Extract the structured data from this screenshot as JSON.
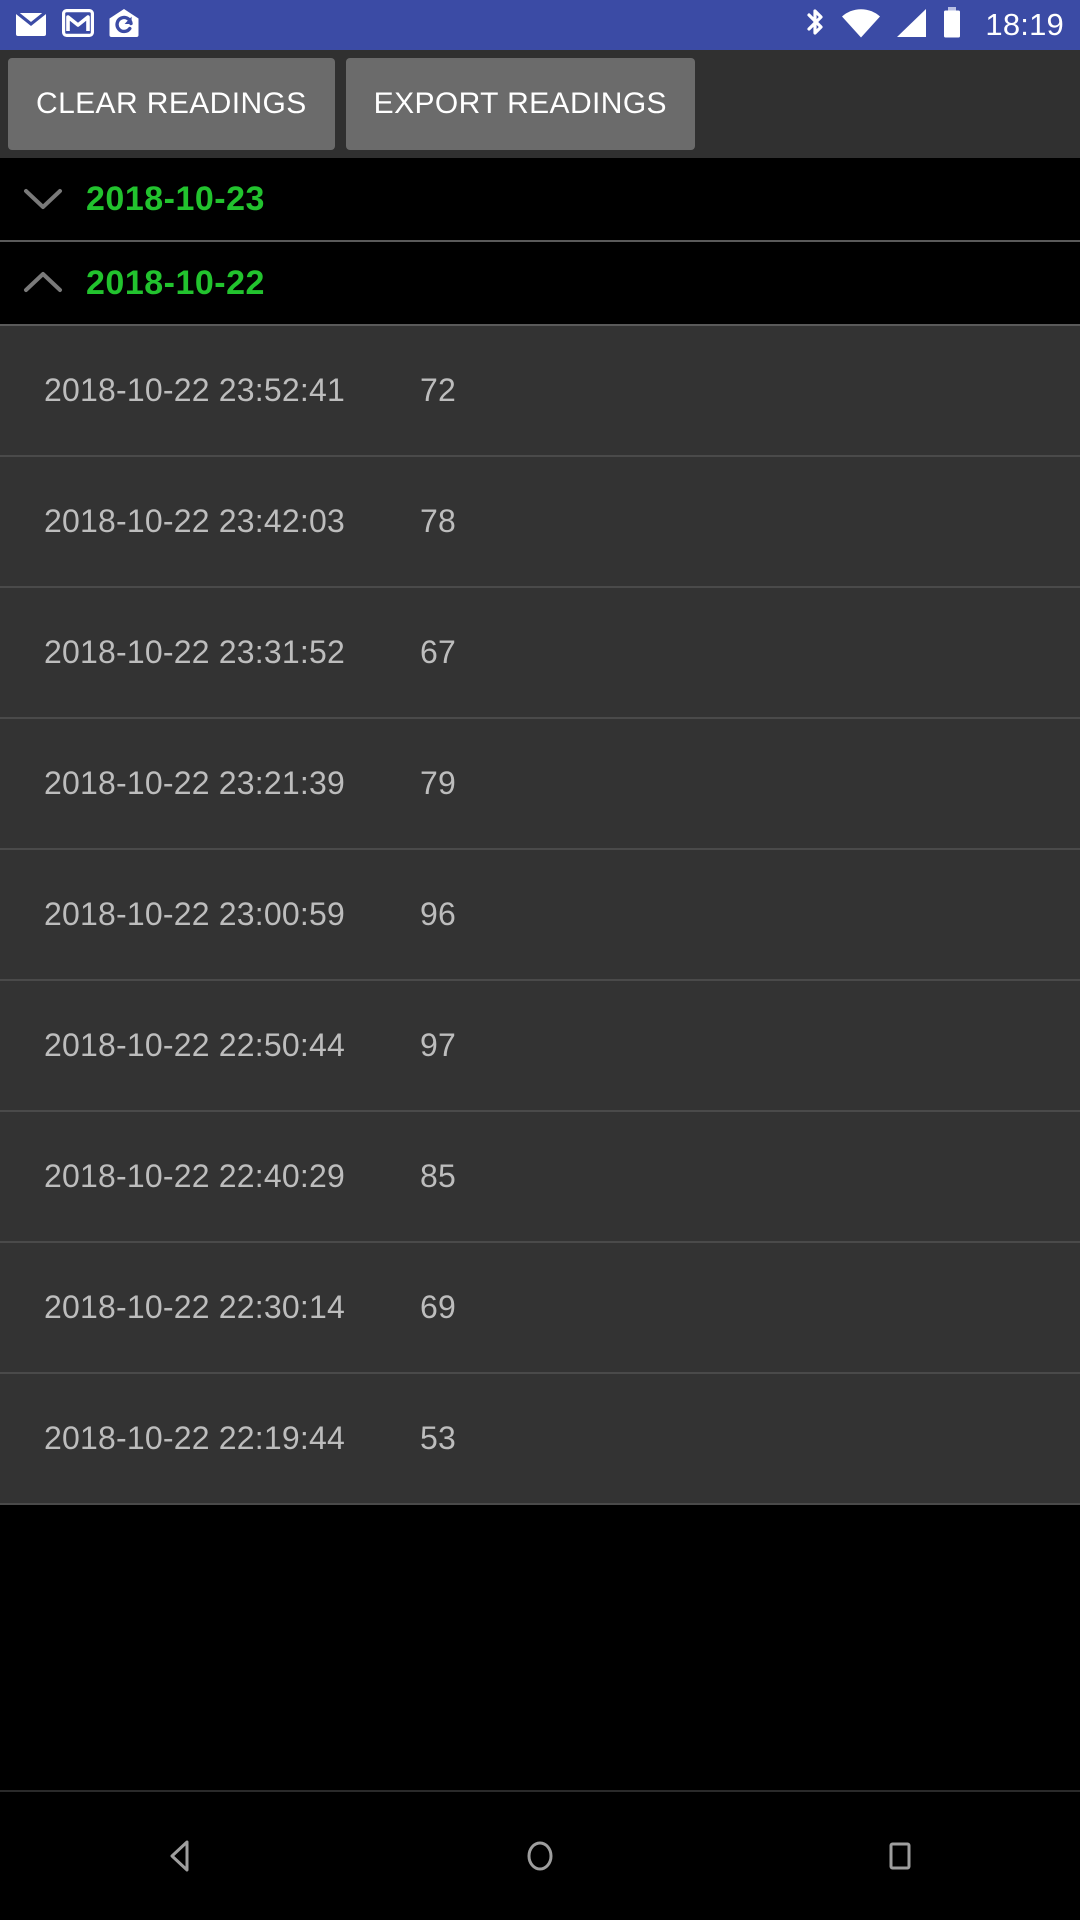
{
  "status_bar": {
    "background_color": "#3b4ba5",
    "time": "18:19",
    "left_icons": [
      {
        "name": "email-envelope-icon"
      },
      {
        "name": "gmail-icon"
      },
      {
        "name": "sync-envelope-icon"
      }
    ],
    "right_icons": [
      {
        "name": "bluetooth-icon"
      },
      {
        "name": "wifi-icon"
      },
      {
        "name": "cell-signal-icon"
      },
      {
        "name": "battery-icon"
      }
    ]
  },
  "toolbar": {
    "background_color": "#303030",
    "button_color": "#6b6b6b",
    "clear_label": "CLEAR READINGS",
    "export_label": "EXPORT READINGS"
  },
  "colors": {
    "group_text": "#22c32e",
    "row_background": "#333333",
    "row_text": "#bdbdbd",
    "group_background": "#000000"
  },
  "groups": [
    {
      "date": "2018-10-23",
      "expanded": false,
      "chevron": "chevron-down-icon",
      "readings": []
    },
    {
      "date": "2018-10-22",
      "expanded": true,
      "chevron": "chevron-up-icon",
      "readings": [
        {
          "timestamp": "2018-10-22 23:52:41",
          "value": "72"
        },
        {
          "timestamp": "2018-10-22 23:42:03",
          "value": "78"
        },
        {
          "timestamp": "2018-10-22 23:31:52",
          "value": "67"
        },
        {
          "timestamp": "2018-10-22 23:21:39",
          "value": "79"
        },
        {
          "timestamp": "2018-10-22 23:00:59",
          "value": "96"
        },
        {
          "timestamp": "2018-10-22 22:50:44",
          "value": "97"
        },
        {
          "timestamp": "2018-10-22 22:40:29",
          "value": "85"
        },
        {
          "timestamp": "2018-10-22 22:30:14",
          "value": "69"
        },
        {
          "timestamp": "2018-10-22 22:19:44",
          "value": "53"
        }
      ]
    }
  ],
  "nav_bar": {
    "back": "back-nav-icon",
    "home": "home-nav-icon",
    "recents": "recents-nav-icon"
  }
}
